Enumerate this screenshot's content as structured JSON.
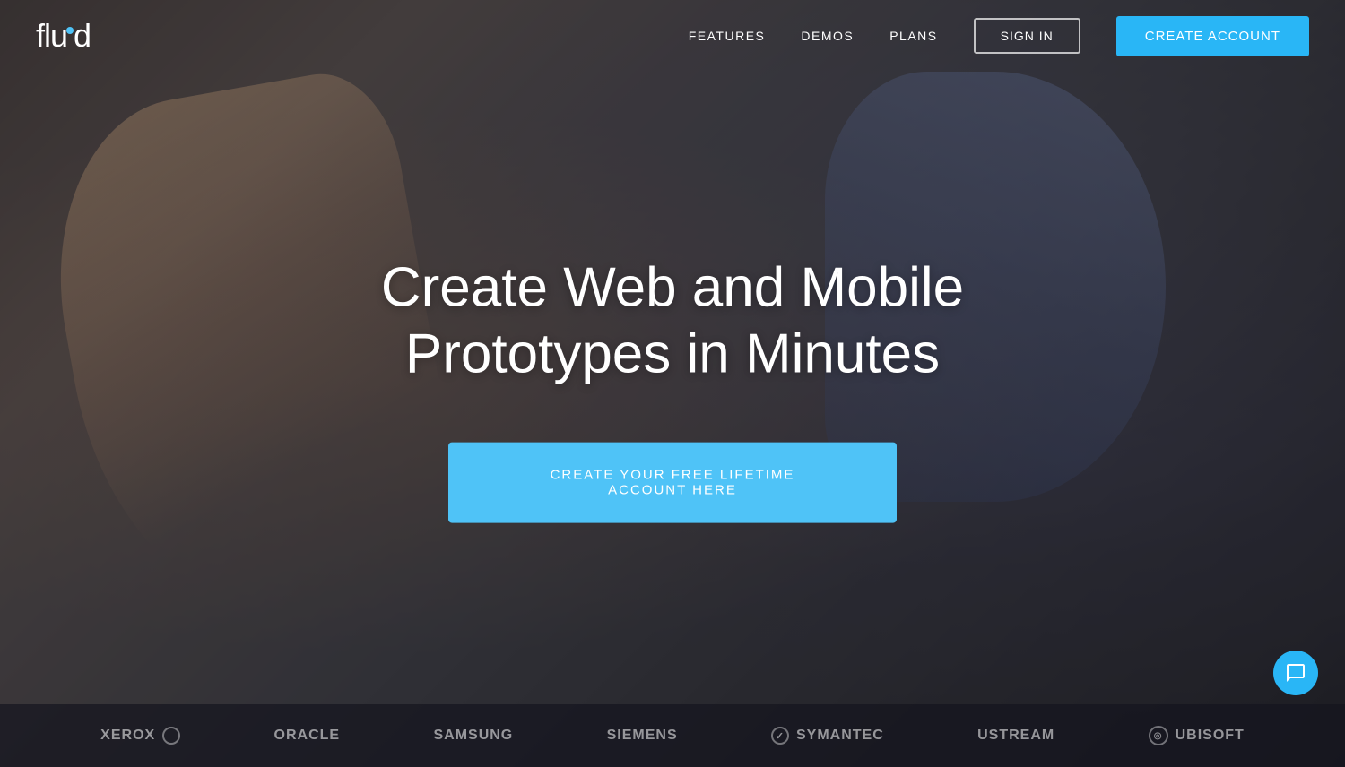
{
  "brand": {
    "name": "fluid",
    "logo_text": "flu",
    "logo_text2": "d"
  },
  "nav": {
    "features_label": "FEATURES",
    "demos_label": "DEMOS",
    "plans_label": "PLANS",
    "signin_label": "SIGN IN",
    "create_account_label": "CREATE ACCOUNT"
  },
  "hero": {
    "headline_line1": "Create Web and Mobile",
    "headline_line2": "Prototypes in Minutes",
    "cta_label": "CREATE YOUR FREE LIFETIME ACCOUNT HERE"
  },
  "brands": [
    {
      "name": "xerox",
      "label": "xerox",
      "has_circle": true
    },
    {
      "name": "oracle",
      "label": "ORACLE",
      "has_circle": false
    },
    {
      "name": "samsung",
      "label": "SAMSUNG",
      "has_circle": false
    },
    {
      "name": "siemens",
      "label": "SIEMENS",
      "has_circle": false
    },
    {
      "name": "symantec",
      "label": "Symantec",
      "has_check": true
    },
    {
      "name": "ustream",
      "label": "USTREAM",
      "has_circle": false
    },
    {
      "name": "ubisoft",
      "label": "ubisoft",
      "has_ring": true
    }
  ],
  "chat": {
    "icon": "chat-icon"
  }
}
